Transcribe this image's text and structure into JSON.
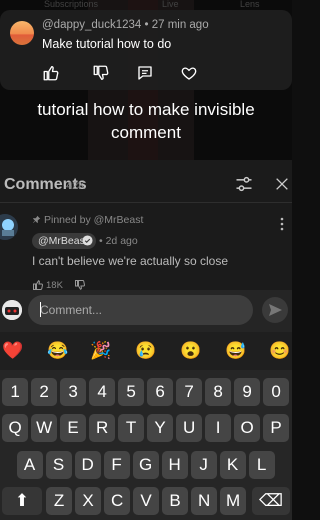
{
  "background_tabs": {
    "tab1": "Subscriptions",
    "tab2": "Live",
    "tab3": "Lens"
  },
  "notification": {
    "username": "@dappy_duck1234",
    "time": "27 min ago",
    "text": "Make tutorial how to do",
    "icons": [
      "thumbs-up-icon",
      "thumbs-down-icon",
      "reply-icon",
      "heart-icon"
    ]
  },
  "overlay": {
    "line1": "tutorial how to make invisible",
    "line2": "comment"
  },
  "comments": {
    "title": "Comments",
    "count": "42K",
    "pinned_label": "Pinned by @MrBeast",
    "pinned_comment": {
      "author": "@MrBeast",
      "time": "2d ago",
      "text": "I can't believe we're actually so close",
      "likes": "18K"
    }
  },
  "composer": {
    "placeholder": "Comment..."
  },
  "emoji_bar": [
    "❤️",
    "😂",
    "🎉",
    "😢",
    "😮",
    "😅",
    "😊"
  ],
  "keyboard": {
    "row_numbers": [
      "1",
      "2",
      "3",
      "4",
      "5",
      "6",
      "7",
      "8",
      "9",
      "0"
    ],
    "row_q": [
      "Q",
      "W",
      "E",
      "R",
      "T",
      "Y",
      "U",
      "I",
      "O",
      "P"
    ],
    "row_a": [
      "A",
      "S",
      "D",
      "F",
      "G",
      "H",
      "J",
      "K",
      "L"
    ],
    "row_z": [
      "Z",
      "X",
      "C",
      "V",
      "B",
      "N",
      "M"
    ],
    "shift_symbol": "⬆",
    "backspace_symbol": "⌫"
  },
  "colors": {
    "accent": "#3ea6ff",
    "background": "#0f0f0f",
    "panel": "#1b1b1b"
  }
}
